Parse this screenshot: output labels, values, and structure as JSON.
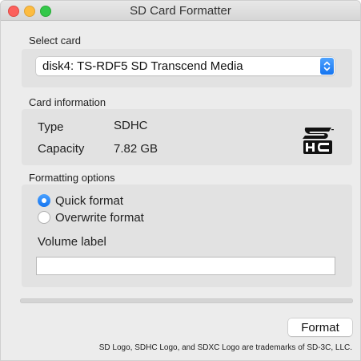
{
  "window": {
    "title": "SD Card Formatter"
  },
  "select_card": {
    "label": "Select card",
    "value": "disk4: TS-RDF5 SD Transcend Media"
  },
  "card_info": {
    "label": "Card information",
    "type_key": "Type",
    "type_value": "SDHC",
    "capacity_key": "Capacity",
    "capacity_value": "7.82 GB",
    "logo": "sdhc-logo"
  },
  "formatting": {
    "label": "Formatting options",
    "options": [
      {
        "label": "Quick format",
        "selected": true
      },
      {
        "label": "Overwrite format",
        "selected": false
      }
    ],
    "volume_label": "Volume label",
    "volume_value": ""
  },
  "progress": {
    "fraction": 0
  },
  "actions": {
    "format_label": "Format"
  },
  "footer": "SD Logo, SDHC Logo, and SDXC Logo are trademarks of SD-3C, LLC.",
  "colors": {
    "accent": "#1474f0",
    "window_bg": "#ececec",
    "group_bg": "#e2e2e2"
  }
}
